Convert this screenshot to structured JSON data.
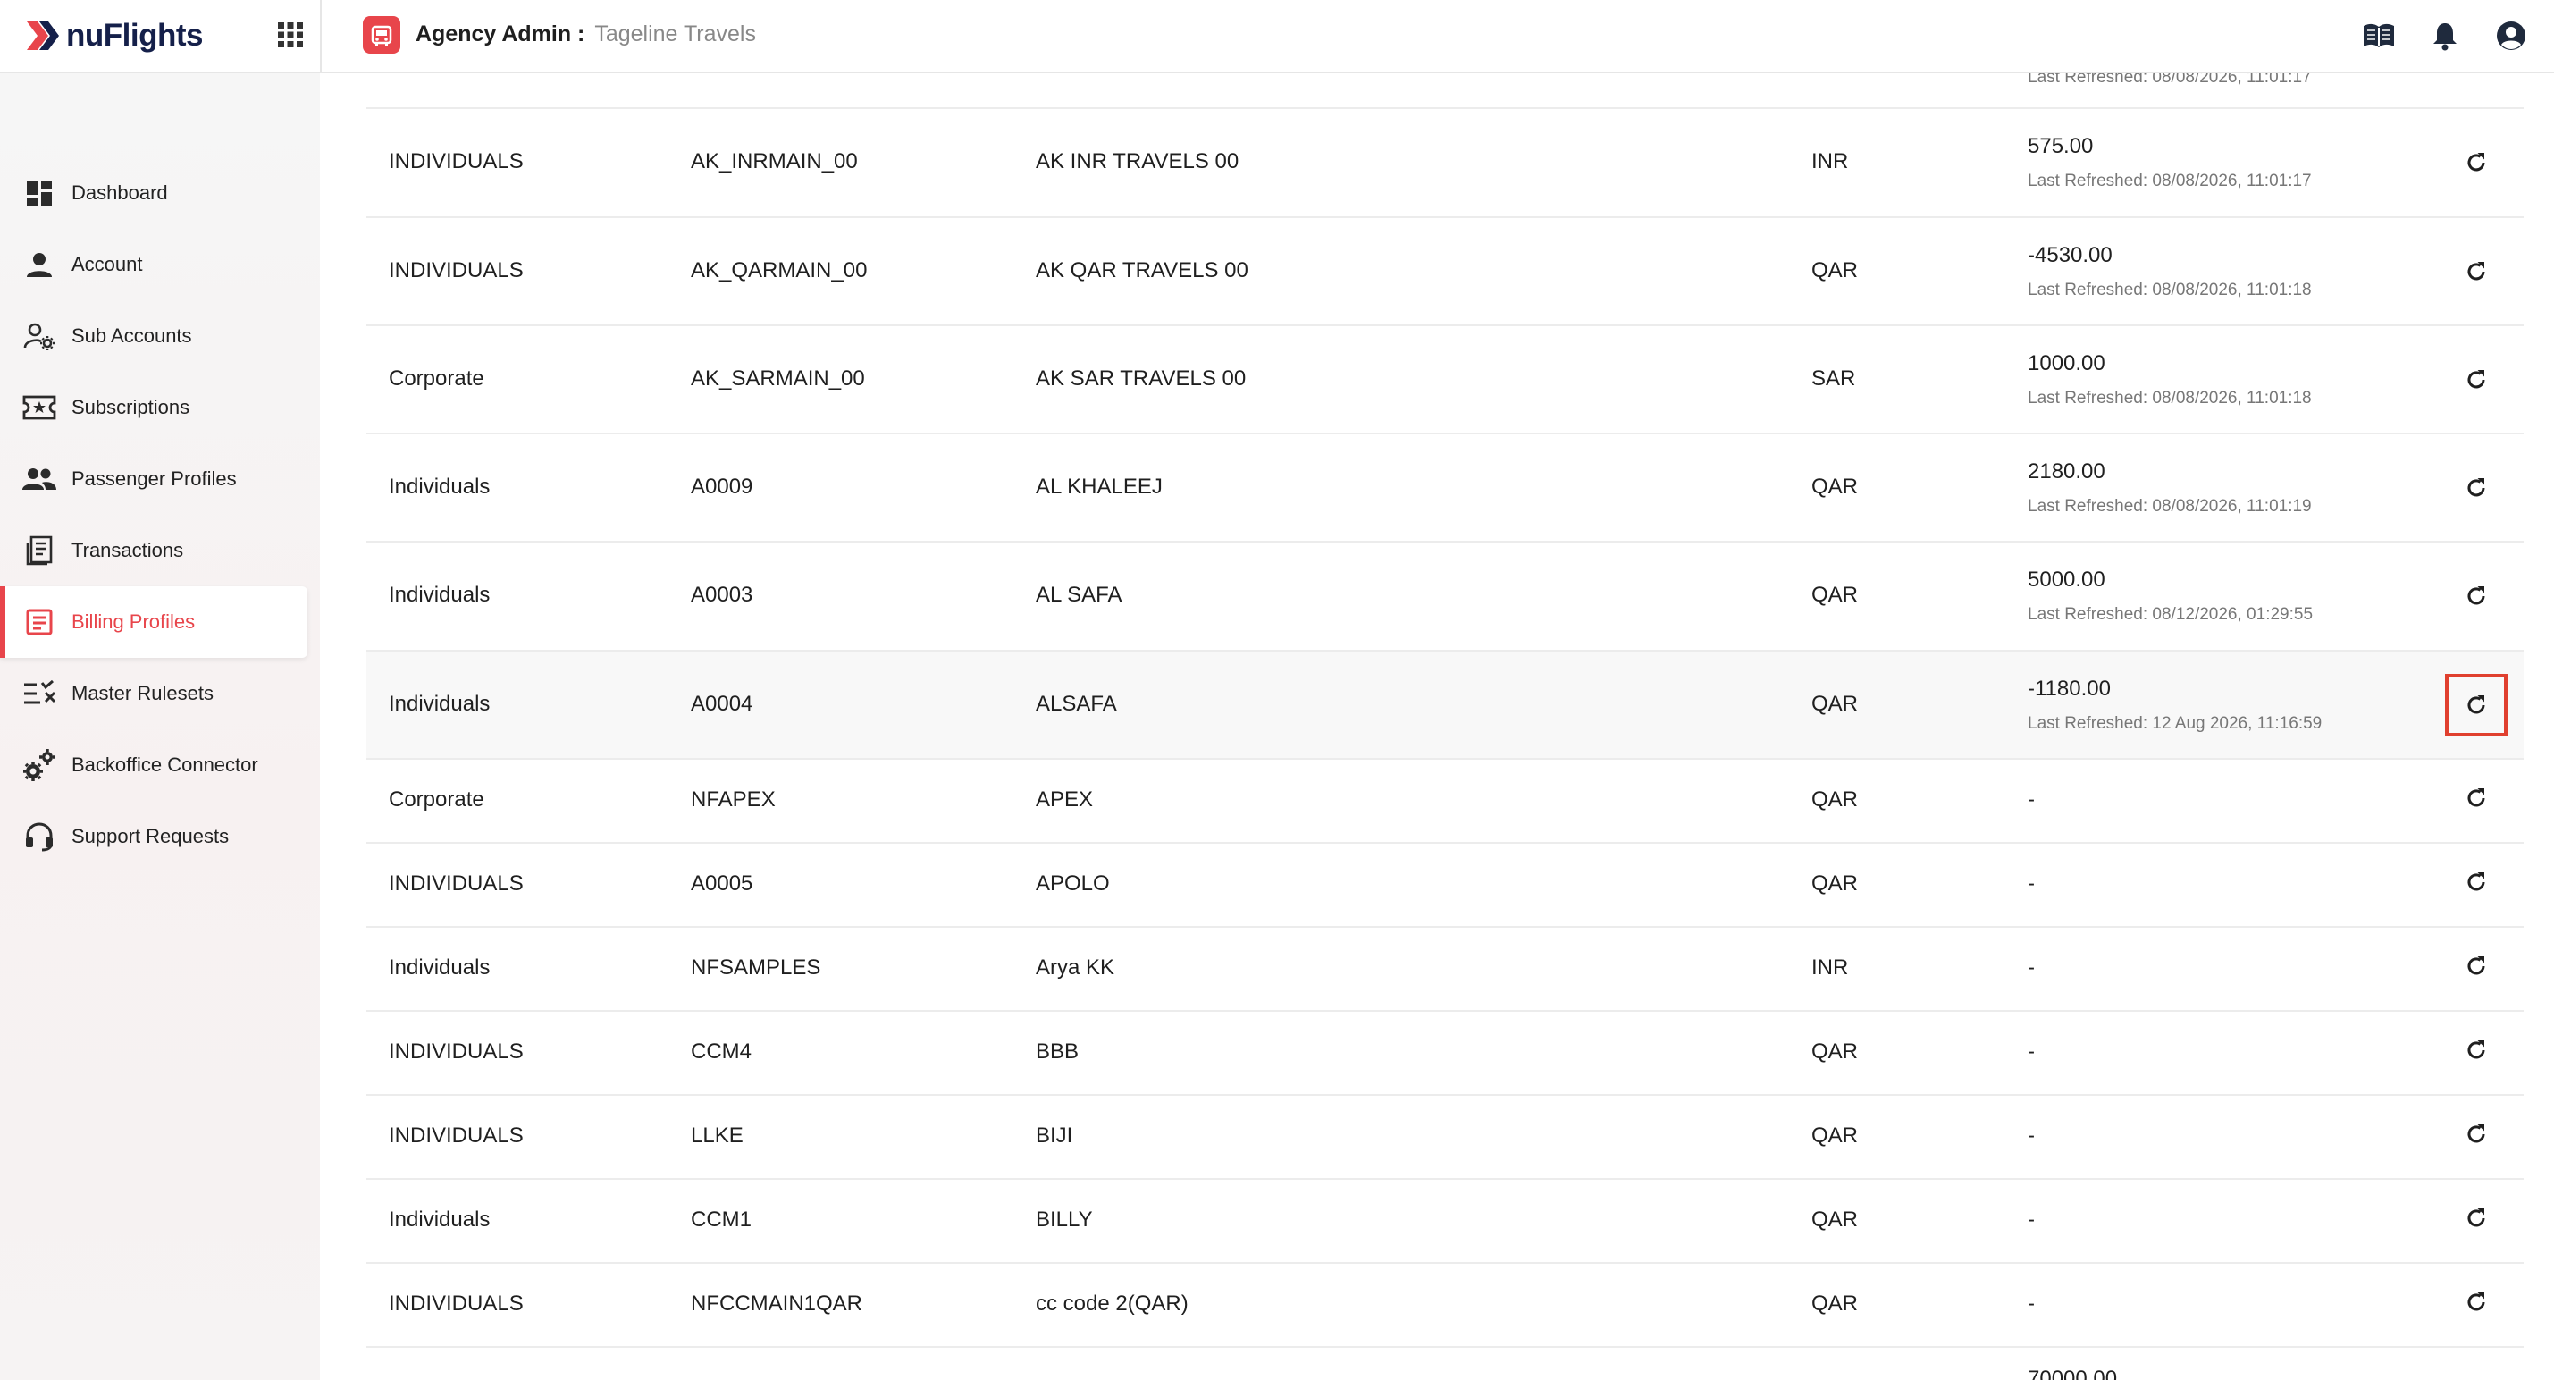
{
  "header": {
    "brand": "nuFlights",
    "role_label": "Agency Admin :",
    "agency_name": "Tageline Travels"
  },
  "colors": {
    "accent": "#e8454b",
    "highlight": "#e0402f",
    "brand_dark": "#15204a"
  },
  "sidebar": {
    "items": [
      {
        "label": "Dashboard",
        "icon": "dashboard-icon"
      },
      {
        "label": "Account",
        "icon": "person-icon"
      },
      {
        "label": "Sub Accounts",
        "icon": "user-settings-icon"
      },
      {
        "label": "Subscriptions",
        "icon": "ticket-star-icon"
      },
      {
        "label": "Passenger Profiles",
        "icon": "people-icon"
      },
      {
        "label": "Transactions",
        "icon": "receipt-icon"
      },
      {
        "label": "Billing Profiles",
        "icon": "billing-icon",
        "active": true
      },
      {
        "label": "Master Rulesets",
        "icon": "rules-list-icon"
      },
      {
        "label": "Backoffice Connector",
        "icon": "gears-icon"
      },
      {
        "label": "Support Requests",
        "icon": "headset-icon"
      }
    ]
  },
  "table": {
    "partial_top_text": "Last Refreshed: 08/08/2026, 11:01:17",
    "partial_bottom_text": "70000.00",
    "rows": [
      {
        "type": "INDIVIDUALS",
        "code": "AK_INRMAIN_00",
        "name": "AK INR TRAVELS 00",
        "currency": "INR",
        "balance": "575.00",
        "refreshed": "Last Refreshed: 08/08/2026, 11:01:17"
      },
      {
        "type": "INDIVIDUALS",
        "code": "AK_QARMAIN_00",
        "name": "AK QAR TRAVELS 00",
        "currency": "QAR",
        "balance": "-4530.00",
        "refreshed": "Last Refreshed: 08/08/2026, 11:01:18"
      },
      {
        "type": "Corporate",
        "code": "AK_SARMAIN_00",
        "name": "AK SAR TRAVELS 00",
        "currency": "SAR",
        "balance": "1000.00",
        "refreshed": "Last Refreshed: 08/08/2026, 11:01:18"
      },
      {
        "type": "Individuals",
        "code": "A0009",
        "name": "AL KHALEEJ",
        "currency": "QAR",
        "balance": "2180.00",
        "refreshed": "Last Refreshed: 08/08/2026, 11:01:19"
      },
      {
        "type": "Individuals",
        "code": "A0003",
        "name": "AL SAFA",
        "currency": "QAR",
        "balance": "5000.00",
        "refreshed": "Last Refreshed: 08/12/2026, 01:29:55"
      },
      {
        "type": "Individuals",
        "code": "A0004",
        "name": "ALSAFA",
        "currency": "QAR",
        "balance": "-1180.00",
        "refreshed": "Last Refreshed: 12 Aug 2026, 11:16:59"
      },
      {
        "type": "Corporate",
        "code": "NFAPEX",
        "name": "APEX",
        "currency": "QAR",
        "balance": "-",
        "refreshed": ""
      },
      {
        "type": "INDIVIDUALS",
        "code": "A0005",
        "name": "APOLO",
        "currency": "QAR",
        "balance": "-",
        "refreshed": ""
      },
      {
        "type": "Individuals",
        "code": "NFSAMPLES",
        "name": "Arya KK",
        "currency": "INR",
        "balance": "-",
        "refreshed": ""
      },
      {
        "type": "INDIVIDUALS",
        "code": "CCM4",
        "name": "BBB",
        "currency": "QAR",
        "balance": "-",
        "refreshed": ""
      },
      {
        "type": "INDIVIDUALS",
        "code": "LLKE",
        "name": "BIJI",
        "currency": "QAR",
        "balance": "-",
        "refreshed": ""
      },
      {
        "type": "Individuals",
        "code": "CCM1",
        "name": "BILLY",
        "currency": "QAR",
        "balance": "-",
        "refreshed": ""
      },
      {
        "type": "INDIVIDUALS",
        "code": "NFCCMAIN1QAR",
        "name": "cc code 2(QAR)",
        "currency": "QAR",
        "balance": "-",
        "refreshed": ""
      }
    ]
  }
}
